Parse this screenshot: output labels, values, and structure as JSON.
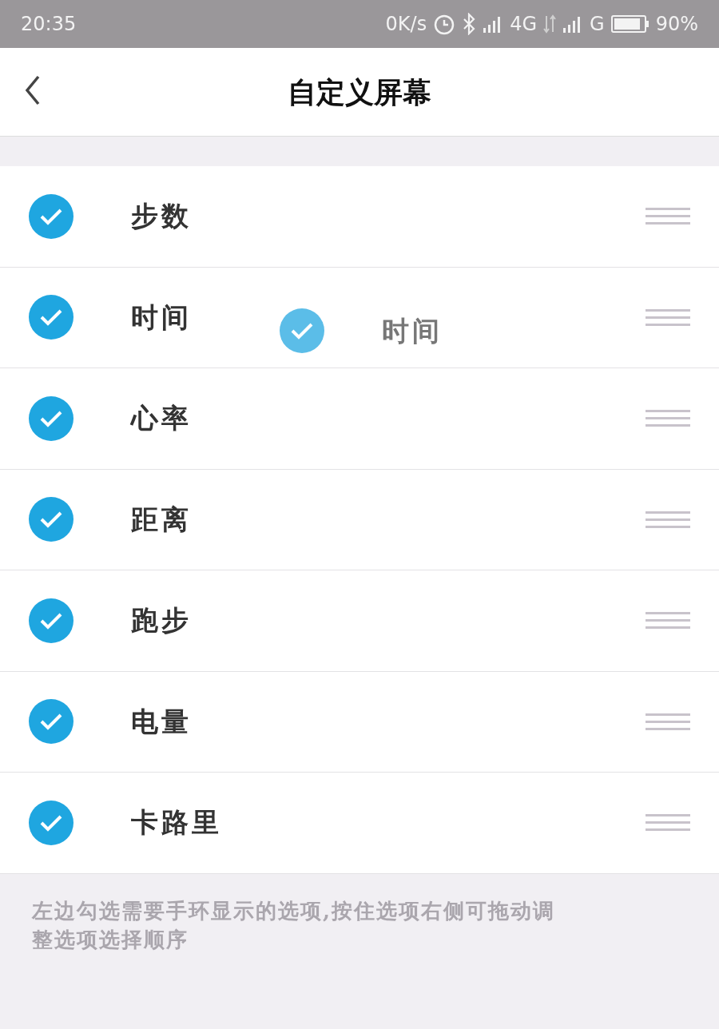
{
  "status_bar": {
    "time": "20:35",
    "speed": "0K/s",
    "network_1": "4G",
    "network_2": "G",
    "battery": "90%"
  },
  "header": {
    "title": "自定义屏幕"
  },
  "items": [
    {
      "label": "步数",
      "checked": true
    },
    {
      "label": "时间",
      "checked": true
    },
    {
      "label": "心率",
      "checked": true
    },
    {
      "label": "距离",
      "checked": true
    },
    {
      "label": "跑步",
      "checked": true
    },
    {
      "label": "电量",
      "checked": true
    },
    {
      "label": "卡路里",
      "checked": true
    }
  ],
  "drag_ghost": {
    "label": "时间",
    "checked": true
  },
  "hint": "左边勾选需要手环显示的选项,按住选项右侧可拖动调整选项选择顺序"
}
